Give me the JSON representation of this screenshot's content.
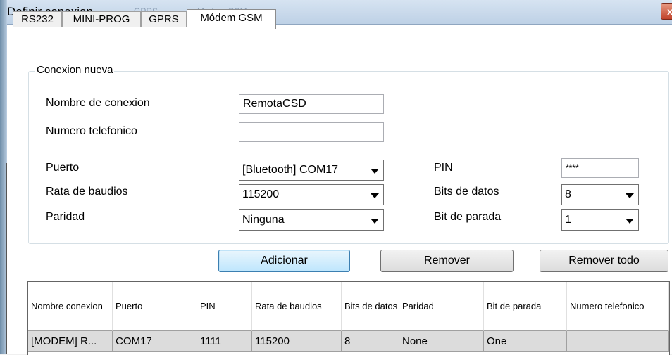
{
  "window": {
    "title": "Definir conexion",
    "ghost_title_1": "GPRS",
    "ghost_title_2": "Modem GSM",
    "close_glyph": "x"
  },
  "tabs": [
    {
      "label": "RS232"
    },
    {
      "label": "MINI-PROG"
    },
    {
      "label": "GPRS"
    },
    {
      "label": "Módem GSM",
      "selected": true
    }
  ],
  "group": {
    "legend": "Conexion nueva",
    "nombre_label": "Nombre de conexion",
    "nombre_value": "RemotaCSD",
    "numero_label": "Numero telefonico",
    "numero_value": "",
    "puerto_label": "Puerto",
    "puerto_value": "[Bluetooth] COM17",
    "rata_label": "Rata de baudios",
    "rata_value": "115200",
    "paridad_label": "Paridad",
    "paridad_value": "Ninguna",
    "pin_label": "PIN",
    "pin_value": "****",
    "bits_label": "Bits de datos",
    "bits_value": "8",
    "parada_label": "Bit de parada",
    "parada_value": "1"
  },
  "buttons": {
    "add": "Adicionar",
    "remove": "Remover",
    "remove_all": "Remover todo"
  },
  "table": {
    "headers": [
      "Nombre conexion",
      "Puerto",
      "PIN",
      "Rata de baudios",
      "Bits de datos",
      "Paridad",
      "Bit de parada",
      "Numero telefonico"
    ],
    "rows": [
      [
        "[MODEM] R...",
        "COM17",
        "1111",
        "115200",
        "8",
        "None",
        "One",
        ""
      ]
    ]
  }
}
